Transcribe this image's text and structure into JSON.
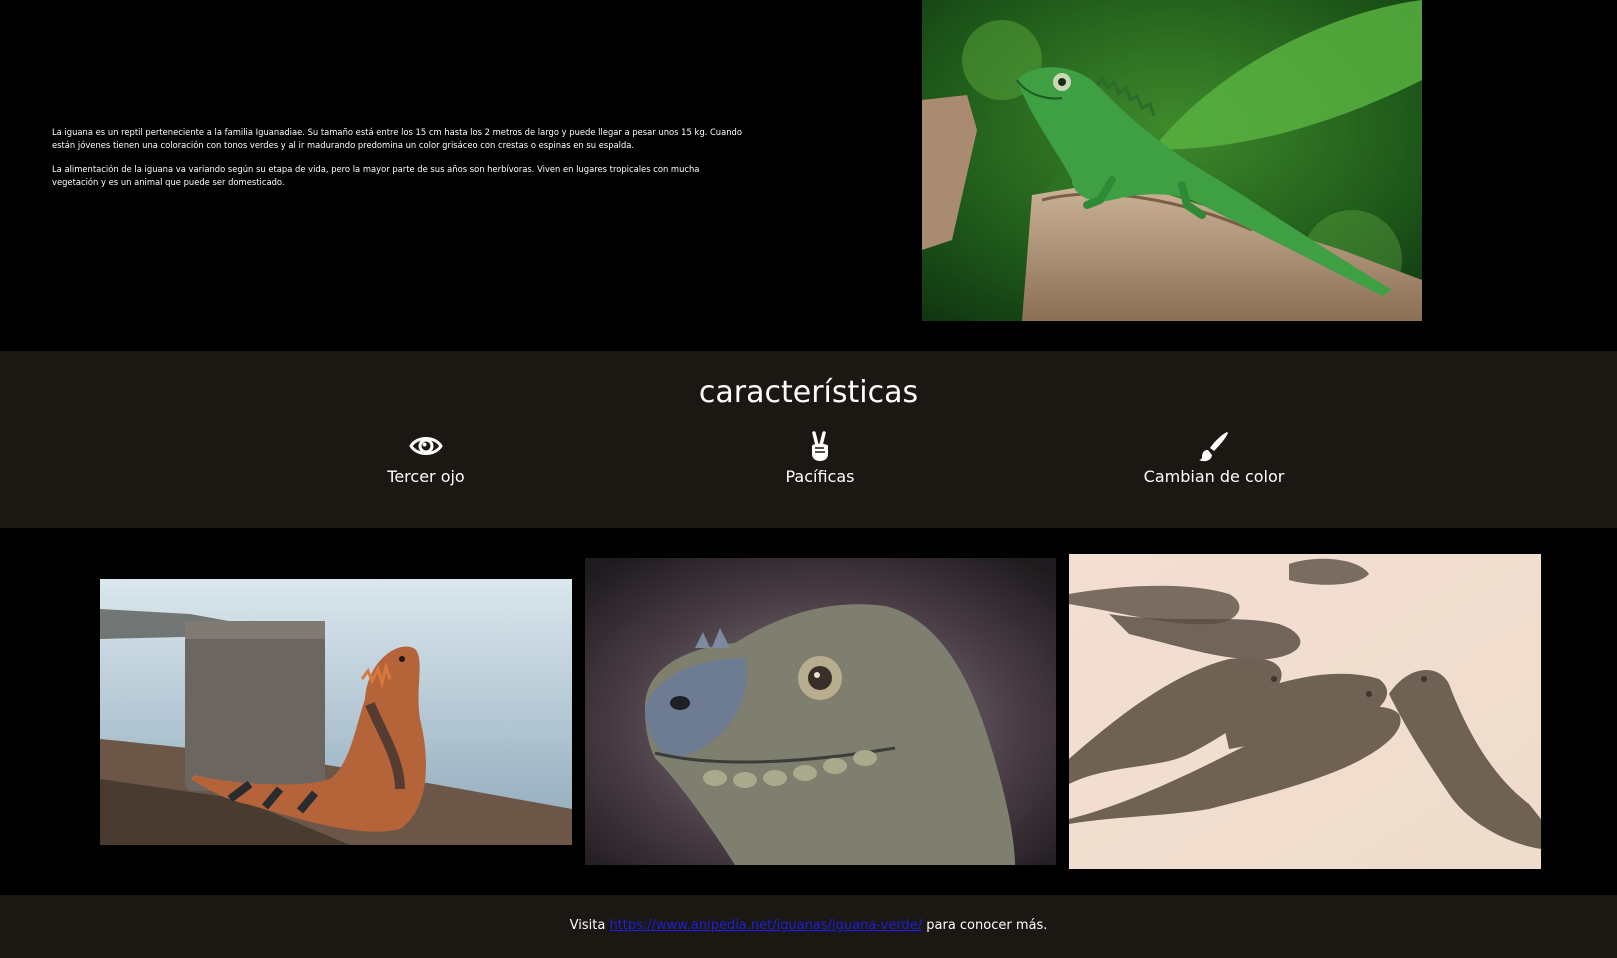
{
  "intro": {
    "paragraph_1": "La iguana es un reptil perteneciente a la familia Iguanadiae. Su tamaño está entre los 15 cm hasta los 2 metros de largo y puede llegar a pesar unos 15 kg. Cuando están jóvenes tienen una coloración con tonos verdes y al ir madurando predomina un color grisáceo con crestas o espinas en su espalda.",
    "paragraph_2": "La alimentación de la iguana va variando según su etapa de vida, pero la mayor parte de sus años son herbívoras. Viven en lugares tropicales con mucha vegetación y es un animal que puede ser domesticado."
  },
  "features": {
    "title": "características",
    "items": [
      {
        "label": "Tercer ojo",
        "icon": "eye-icon"
      },
      {
        "label": "Pacíficas",
        "icon": "peace-hand-icon"
      },
      {
        "label": "Cambian de color",
        "icon": "paintbrush-icon"
      }
    ]
  },
  "footer": {
    "prefix": "Visita",
    "link_text": "https://www.anipedia.net/iguanas/iguana-verde/",
    "suffix": "para conocer más."
  },
  "colors": {
    "background": "#000000",
    "band": "#1b1813",
    "link": "#1e1edc"
  }
}
